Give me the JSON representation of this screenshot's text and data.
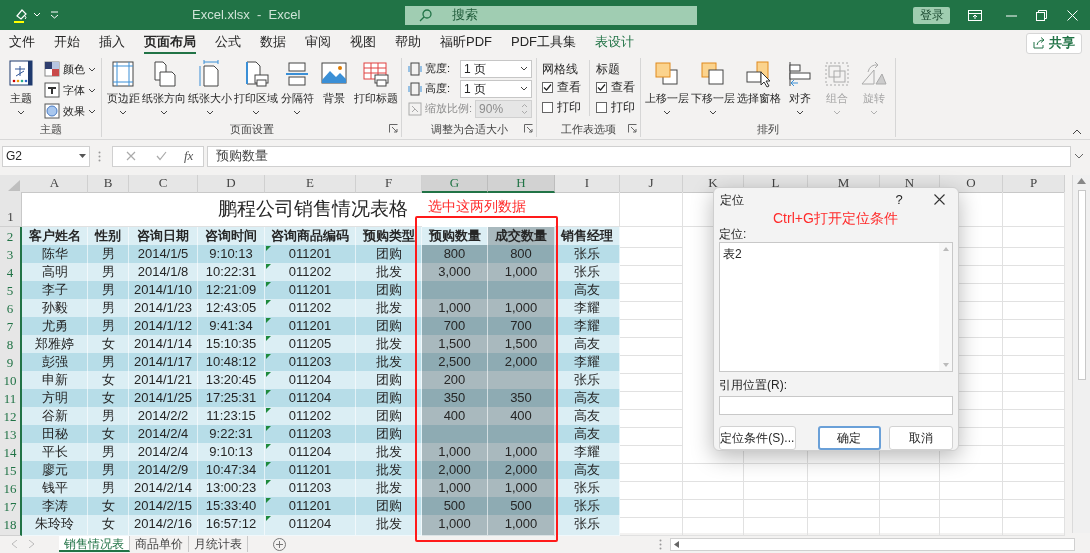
{
  "title_bar": {
    "title": "Excel.xlsx  -  Excel",
    "search_placeholder": "搜索",
    "sign_in": "登录"
  },
  "ribbon_tabs": [
    {
      "label": "文件",
      "selected": false,
      "contextual": false
    },
    {
      "label": "开始",
      "selected": false,
      "contextual": false
    },
    {
      "label": "插入",
      "selected": false,
      "contextual": false
    },
    {
      "label": "页面布局",
      "selected": true,
      "contextual": false
    },
    {
      "label": "公式",
      "selected": false,
      "contextual": false
    },
    {
      "label": "数据",
      "selected": false,
      "contextual": false
    },
    {
      "label": "审阅",
      "selected": false,
      "contextual": false
    },
    {
      "label": "视图",
      "selected": false,
      "contextual": false
    },
    {
      "label": "帮助",
      "selected": false,
      "contextual": false
    },
    {
      "label": "福昕PDF",
      "selected": false,
      "contextual": false
    },
    {
      "label": "PDF工具集",
      "selected": false,
      "contextual": false
    },
    {
      "label": "表设计",
      "selected": false,
      "contextual": true
    }
  ],
  "share": "共享",
  "ribbon_groups": [
    {
      "label": "主题",
      "launcher": false,
      "items": [
        {
          "kind": "large",
          "label": "主题",
          "dropdown": true,
          "disabled": false
        },
        {
          "kind": "small",
          "label": "颜色",
          "dropdown": true
        },
        {
          "kind": "small",
          "label": "字体",
          "dropdown": true
        },
        {
          "kind": "small",
          "label": "效果",
          "dropdown": true
        }
      ]
    },
    {
      "label": "页面设置",
      "launcher": true,
      "items": [
        {
          "kind": "large",
          "label": "页边距",
          "dropdown": true,
          "disabled": false
        },
        {
          "kind": "large",
          "label": "纸张方向",
          "dropdown": true,
          "disabled": false
        },
        {
          "kind": "large",
          "label": "纸张大小",
          "dropdown": true,
          "disabled": false
        },
        {
          "kind": "large",
          "label": "打印区域",
          "dropdown": true,
          "disabled": false
        },
        {
          "kind": "large",
          "label": "分隔符",
          "dropdown": true,
          "disabled": false
        },
        {
          "kind": "large",
          "label": "背景",
          "dropdown": false,
          "disabled": false
        },
        {
          "kind": "large",
          "label": "打印标题",
          "dropdown": false,
          "disabled": false
        }
      ]
    },
    {
      "label": "调整为合适大小",
      "launcher": true,
      "items": [
        {
          "kind": "dropdown",
          "label": "宽度:",
          "value": "1 页",
          "disabled": false
        },
        {
          "kind": "dropdown",
          "label": "高度:",
          "value": "1 页",
          "disabled": false
        },
        {
          "kind": "spin",
          "label": "缩放比例:",
          "value": "90%",
          "disabled": true
        }
      ]
    },
    {
      "label": "工作表选项",
      "launcher": true,
      "items": [
        {
          "kind": "checks",
          "heading": "网格线",
          "options": [
            {
              "label": "查看",
              "checked": true
            },
            {
              "label": "打印",
              "checked": false
            }
          ]
        },
        {
          "kind": "checks",
          "heading": "标题",
          "options": [
            {
              "label": "查看",
              "checked": true
            },
            {
              "label": "打印",
              "checked": false
            }
          ]
        }
      ]
    },
    {
      "label": "排列",
      "launcher": false,
      "items": [
        {
          "kind": "large",
          "label": "上移一层",
          "dropdown": true,
          "disabled": false
        },
        {
          "kind": "large",
          "label": "下移一层",
          "dropdown": true,
          "disabled": false
        },
        {
          "kind": "large",
          "label": "选择窗格",
          "dropdown": false,
          "disabled": false
        },
        {
          "kind": "large",
          "label": "对齐",
          "dropdown": true,
          "disabled": false
        },
        {
          "kind": "large",
          "label": "组合",
          "dropdown": true,
          "disabled": true
        },
        {
          "kind": "large",
          "label": "旋转",
          "dropdown": true,
          "disabled": true
        }
      ]
    }
  ],
  "formula_bar": {
    "name_box": "G2",
    "fx": "fx",
    "formula": "预购数量"
  },
  "sheet": {
    "columns": [
      {
        "label": "A",
        "selected": false
      },
      {
        "label": "B",
        "selected": false
      },
      {
        "label": "C",
        "selected": false
      },
      {
        "label": "D",
        "selected": false
      },
      {
        "label": "E",
        "selected": false
      },
      {
        "label": "F",
        "selected": false
      },
      {
        "label": "G",
        "selected": true
      },
      {
        "label": "H",
        "selected": true
      },
      {
        "label": "I",
        "selected": false
      },
      {
        "label": "J",
        "selected": false
      },
      {
        "label": "K",
        "selected": false
      },
      {
        "label": "L",
        "selected": false
      },
      {
        "label": "M",
        "selected": false
      },
      {
        "label": "N",
        "selected": false
      },
      {
        "label": "O",
        "selected": false
      },
      {
        "label": "P",
        "selected": false
      }
    ],
    "title_row": {
      "row_number": "1",
      "selected": false,
      "title": "鹏程公司销售情况表格"
    },
    "header_row": {
      "row_number": "2",
      "selected": true,
      "cells": [
        "客户姓名",
        "性别",
        "咨询日期",
        "咨询时间",
        "咨询商品编码",
        "预购类型",
        "预购数量",
        "成交数量",
        "销售经理"
      ]
    },
    "rows": [
      {
        "row_number": "3",
        "selected": true,
        "code_flag": true,
        "cells": [
          "陈华",
          "男",
          "2014/1/5",
          "9:10:13",
          "011201",
          "团购",
          "800",
          "800",
          "张乐"
        ]
      },
      {
        "row_number": "4",
        "selected": true,
        "code_flag": true,
        "cells": [
          "高明",
          "男",
          "2014/1/8",
          "10:22:31",
          "011202",
          "批发",
          "3,000",
          "1,000",
          "张乐"
        ]
      },
      {
        "row_number": "5",
        "selected": true,
        "code_flag": true,
        "cells": [
          "李子",
          "男",
          "2014/1/10",
          "12:21:09",
          "011201",
          "团购",
          null,
          null,
          "高友"
        ]
      },
      {
        "row_number": "6",
        "selected": true,
        "code_flag": true,
        "cells": [
          "孙毅",
          "男",
          "2014/1/23",
          "12:43:05",
          "011202",
          "批发",
          "1,000",
          "1,000",
          "李耀"
        ]
      },
      {
        "row_number": "7",
        "selected": true,
        "code_flag": true,
        "cells": [
          "尤勇",
          "男",
          "2014/1/12",
          "9:41:34",
          "011201",
          "团购",
          "700",
          "700",
          "李耀"
        ]
      },
      {
        "row_number": "8",
        "selected": true,
        "code_flag": true,
        "cells": [
          "郑雅婷",
          "女",
          "2014/1/14",
          "15:10:35",
          "011205",
          "批发",
          "1,500",
          "1,500",
          "高友"
        ]
      },
      {
        "row_number": "9",
        "selected": true,
        "code_flag": true,
        "cells": [
          "彭强",
          "男",
          "2014/1/17",
          "10:48:12",
          "011203",
          "批发",
          "2,500",
          "2,000",
          "李耀"
        ]
      },
      {
        "row_number": "10",
        "selected": true,
        "code_flag": true,
        "cells": [
          "申新",
          "女",
          "2014/1/21",
          "13:20:45",
          "011204",
          "团购",
          "200",
          null,
          "张乐"
        ]
      },
      {
        "row_number": "11",
        "selected": true,
        "code_flag": true,
        "cells": [
          "方明",
          "女",
          "2014/1/25",
          "17:25:31",
          "011204",
          "团购",
          "350",
          "350",
          "高友"
        ]
      },
      {
        "row_number": "12",
        "selected": true,
        "code_flag": true,
        "cells": [
          "谷新",
          "男",
          "2014/2/2",
          "11:23:15",
          "011202",
          "团购",
          "400",
          "400",
          "高友"
        ]
      },
      {
        "row_number": "13",
        "selected": true,
        "code_flag": true,
        "cells": [
          "田秘",
          "女",
          "2014/2/4",
          "9:22:31",
          "011203",
          "团购",
          null,
          null,
          "高友"
        ]
      },
      {
        "row_number": "14",
        "selected": true,
        "code_flag": true,
        "cells": [
          "平长",
          "男",
          "2014/2/4",
          "9:10:13",
          "011204",
          "批发",
          "1,000",
          "1,000",
          "李耀"
        ]
      },
      {
        "row_number": "15",
        "selected": true,
        "code_flag": true,
        "cells": [
          "廖元",
          "男",
          "2014/2/9",
          "10:47:34",
          "011201",
          "批发",
          "2,000",
          "2,000",
          "高友"
        ]
      },
      {
        "row_number": "16",
        "selected": true,
        "code_flag": true,
        "cells": [
          "钱平",
          "男",
          "2014/2/14",
          "13:00:23",
          "011203",
          "批发",
          "1,000",
          "1,000",
          "张乐"
        ]
      },
      {
        "row_number": "17",
        "selected": true,
        "code_flag": true,
        "cells": [
          "李涛",
          "女",
          "2014/2/15",
          "15:33:40",
          "011201",
          "团购",
          "500",
          "500",
          "张乐"
        ]
      },
      {
        "row_number": "18",
        "selected": true,
        "code_flag": true,
        "cells": [
          "朱玲玲",
          "女",
          "2014/2/16",
          "16:57:12",
          "011204",
          "批发",
          "1,000",
          "1,000",
          "张乐"
        ]
      }
    ]
  },
  "sheet_tabs": [
    {
      "label": "销售情况表",
      "selected": true
    },
    {
      "label": "商品单价",
      "selected": false
    },
    {
      "label": "月统计表",
      "selected": false
    }
  ],
  "annotations": {
    "column_note": "选中这两列数据",
    "dialog_note": "Ctrl+G打开定位条件"
  },
  "dialog": {
    "title": "定位",
    "help": "?",
    "list_label": "定位:",
    "list_items": [
      "表2"
    ],
    "reference_label": "引用位置(R):",
    "buttons": [
      {
        "label": "定位条件(S)...",
        "default": false
      },
      {
        "label": "确定",
        "default": true
      },
      {
        "label": "取消",
        "default": false
      }
    ]
  }
}
